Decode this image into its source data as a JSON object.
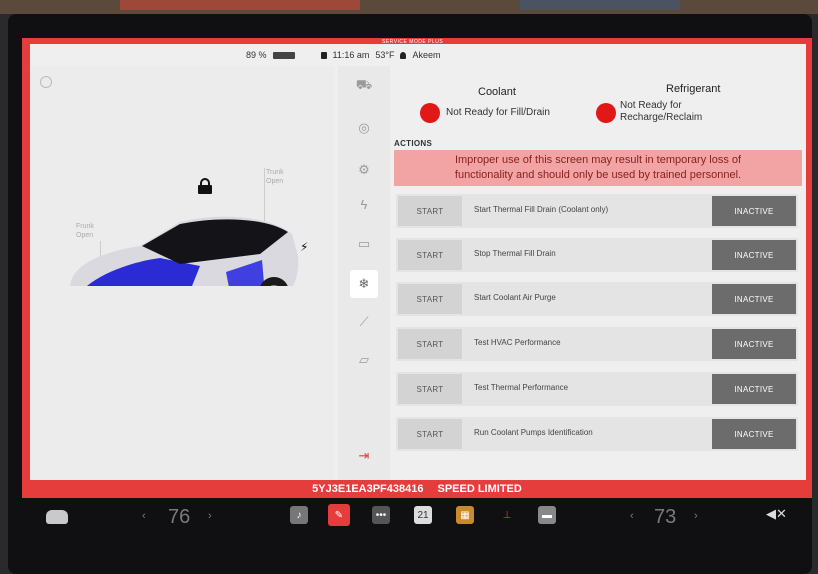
{
  "status_bar": {
    "battery": "89 %",
    "time": "11:16 am",
    "temperature": "53°F",
    "profile": "Akeem",
    "service_banner": "SERVICE MODE PLUS"
  },
  "car_panel": {
    "frunk_label": "Frunk",
    "frunk_state": "Open",
    "trunk_label": "Trunk",
    "trunk_state": "Open"
  },
  "rail": {
    "icons": [
      "car-icon",
      "tire-icon",
      "gear-icon",
      "bolt-icon",
      "battery-icon",
      "snowflake-icon",
      "wrench-icon",
      "folder-icon",
      "exit-icon"
    ],
    "active": "snowflake-icon"
  },
  "coolant": {
    "title": "Coolant",
    "status": "Not Ready for Fill/Drain",
    "status_color": "#e01818"
  },
  "refrigerant": {
    "title": "Refrigerant",
    "status_line1": "Not Ready for",
    "status_line2": "Recharge/Reclaim",
    "status_color": "#e01818"
  },
  "actions": {
    "label": "ACTIONS",
    "warning_line1": "Improper use of this screen may result in temporary loss of",
    "warning_line2": "functionality and should only be used by trained personnel.",
    "rows": [
      {
        "start": "START",
        "label": "Start Thermal Fill Drain (Coolant only)",
        "state": "INACTIVE"
      },
      {
        "start": "START",
        "label": "Stop Thermal Fill Drain",
        "state": "INACTIVE"
      },
      {
        "start": "START",
        "label": "Start Coolant Air Purge",
        "state": "INACTIVE"
      },
      {
        "start": "START",
        "label": "Test HVAC Performance",
        "state": "INACTIVE"
      },
      {
        "start": "START",
        "label": "Test Thermal Performance",
        "state": "INACTIVE"
      },
      {
        "start": "START",
        "label": "Run Coolant Pumps Identification",
        "state": "INACTIVE"
      }
    ]
  },
  "banner": {
    "vin": "5YJ3E1EA3PF438416",
    "speed": "SPEED LIMITED"
  },
  "dock": {
    "left_temp": "76",
    "right_temp": "73",
    "calendar_day": "21",
    "icons": [
      "music-icon",
      "wrench-icon",
      "more-icon",
      "calendar-icon",
      "apps-icon",
      "joystick-icon",
      "toybox-icon"
    ]
  },
  "colors": {
    "frame_red": "#e53c3c",
    "warning_bg": "#f2a4a4",
    "inactive_bg": "#6c6c6c"
  }
}
